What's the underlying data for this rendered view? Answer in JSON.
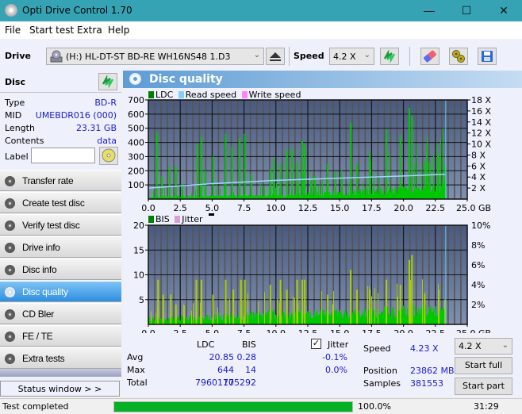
{
  "window": {
    "title": "Opti Drive Control 1.70",
    "min_icon": "minimize-icon",
    "max_icon": "maximize-icon",
    "close_icon": "close-icon"
  },
  "menu": [
    "File",
    "Start test",
    "Extra",
    "Help"
  ],
  "toolbar": {
    "drive_label": "Drive",
    "drive_value": "(H:)  HL-DT-ST BD-RE  WH16NS48 1.D3",
    "speed_label": "Speed",
    "speed_value": "4.2 X",
    "icons": [
      "drive-icon",
      "eject-icon",
      "refresh-icon",
      "eraser-icon",
      "settings-icon",
      "save-icon"
    ]
  },
  "disc": {
    "header": "Disc",
    "fields": [
      {
        "key": "Type",
        "value": "BD-R"
      },
      {
        "key": "MID",
        "value": "UMEBDR016 (000)"
      },
      {
        "key": "Length",
        "value": "23.31 GB"
      },
      {
        "key": "Contents",
        "value": "data"
      }
    ],
    "label_key": "Label",
    "label_value": ""
  },
  "nav": [
    {
      "label": "Transfer rate",
      "active": false
    },
    {
      "label": "Create test disc",
      "active": false
    },
    {
      "label": "Verify test disc",
      "active": false
    },
    {
      "label": "Drive info",
      "active": false
    },
    {
      "label": "Disc info",
      "active": false
    },
    {
      "label": "Disc quality",
      "active": true
    },
    {
      "label": "CD Bler",
      "active": false
    },
    {
      "label": "FE / TE",
      "active": false
    },
    {
      "label": "Extra tests",
      "active": false
    }
  ],
  "status_window_btn": "Status window > >",
  "panel_title": "Disc quality",
  "colors": {
    "ldc": "#008000",
    "read_speed": "#87cefa",
    "write_speed": "#ff80ff",
    "bis": "#008000",
    "jitter": "#d8a0d8",
    "bar_green": "#00c800",
    "bar_yellow": "#a8d000",
    "plot_bg_top": "#4a5a7e",
    "plot_bg_bottom": "#8090b0",
    "progress": "#06b025"
  },
  "chart_data": [
    {
      "type": "bar",
      "title": "LDC / Read speed",
      "legend": [
        "LDC",
        "Read speed",
        "Write speed"
      ],
      "legend_position": "top-left",
      "x_ticks": [
        "0.0",
        "2.5",
        "5.0",
        "7.5",
        "10.0",
        "12.5",
        "15.0",
        "17.5",
        "20.0",
        "22.5",
        "25.0 GB"
      ],
      "xlim": [
        0,
        25
      ],
      "y_ticks": [
        "100",
        "200",
        "300",
        "400",
        "500",
        "600",
        "700"
      ],
      "ylim": [
        0,
        700
      ],
      "y2_ticks": [
        "2 X",
        "4 X",
        "6 X",
        "8 X",
        "10 X",
        "12 X",
        "14 X",
        "16 X",
        "18 X"
      ],
      "y2lim": [
        0,
        18
      ],
      "grid": true,
      "end_marker_gb": 23.31,
      "ldc_peaks": [
        {
          "x": 0.6,
          "y": 470
        },
        {
          "x": 1.0,
          "y": 160
        },
        {
          "x": 1.6,
          "y": 230
        },
        {
          "x": 2.1,
          "y": 230
        },
        {
          "x": 2.6,
          "y": 110
        },
        {
          "x": 3.8,
          "y": 380
        },
        {
          "x": 4.1,
          "y": 440
        },
        {
          "x": 4.4,
          "y": 200
        },
        {
          "x": 5.0,
          "y": 300
        },
        {
          "x": 6.0,
          "y": 460
        },
        {
          "x": 6.5,
          "y": 370
        },
        {
          "x": 7.1,
          "y": 430
        },
        {
          "x": 7.5,
          "y": 460
        },
        {
          "x": 8.0,
          "y": 180
        },
        {
          "x": 9.5,
          "y": 210
        },
        {
          "x": 9.8,
          "y": 290
        },
        {
          "x": 10.3,
          "y": 250
        },
        {
          "x": 10.8,
          "y": 350
        },
        {
          "x": 11.2,
          "y": 360
        },
        {
          "x": 11.6,
          "y": 260
        },
        {
          "x": 12.0,
          "y": 410
        },
        {
          "x": 12.2,
          "y": 380
        },
        {
          "x": 13.0,
          "y": 160
        },
        {
          "x": 14.0,
          "y": 250
        },
        {
          "x": 14.6,
          "y": 190
        },
        {
          "x": 15.8,
          "y": 540
        },
        {
          "x": 16.3,
          "y": 250
        },
        {
          "x": 17.3,
          "y": 330
        },
        {
          "x": 18.6,
          "y": 490
        },
        {
          "x": 19.7,
          "y": 450
        },
        {
          "x": 20.4,
          "y": 644
        },
        {
          "x": 20.6,
          "y": 590
        },
        {
          "x": 21.6,
          "y": 270
        },
        {
          "x": 22.0,
          "y": 260
        },
        {
          "x": 22.7,
          "y": 310
        },
        {
          "x": 23.2,
          "y": 240
        }
      ],
      "ldc_baseline": [
        {
          "x": 0,
          "y": 15
        },
        {
          "x": 10,
          "y": 25
        },
        {
          "x": 15,
          "y": 40
        },
        {
          "x": 20,
          "y": 70
        },
        {
          "x": 23.31,
          "y": 90
        }
      ],
      "read_speed": [
        {
          "x": 0,
          "y": 2.0
        },
        {
          "x": 2.5,
          "y": 2.4
        },
        {
          "x": 5.0,
          "y": 2.8
        },
        {
          "x": 7.5,
          "y": 3.1
        },
        {
          "x": 10.0,
          "y": 3.4
        },
        {
          "x": 12.5,
          "y": 3.6
        },
        {
          "x": 15.0,
          "y": 3.8
        },
        {
          "x": 17.5,
          "y": 4.0
        },
        {
          "x": 20.0,
          "y": 4.2
        },
        {
          "x": 23.31,
          "y": 4.5
        }
      ]
    },
    {
      "type": "bar",
      "title": "BIS / Jitter",
      "legend": [
        "BIS",
        "Jitter"
      ],
      "legend_position": "top-left",
      "x_ticks": [
        "0.0",
        "2.5",
        "5.0",
        "7.5",
        "10.0",
        "12.5",
        "15.0",
        "17.5",
        "20.0",
        "22.5",
        "25.0 GB"
      ],
      "xlim": [
        0,
        25
      ],
      "y_ticks": [
        "5",
        "10",
        "15",
        "20"
      ],
      "ylim": [
        0,
        20
      ],
      "y2_ticks": [
        "2%",
        "4%",
        "6%",
        "8%",
        "10%"
      ],
      "y2lim": [
        0,
        10
      ],
      "grid": true,
      "end_marker_gb": 23.31,
      "bis_peaks": [
        {
          "x": 0.7,
          "y": 9
        },
        {
          "x": 1.1,
          "y": 6
        },
        {
          "x": 1.7,
          "y": 6
        },
        {
          "x": 2.1,
          "y": 4
        },
        {
          "x": 3.7,
          "y": 9
        },
        {
          "x": 4.1,
          "y": 9
        },
        {
          "x": 5.0,
          "y": 6
        },
        {
          "x": 6.0,
          "y": 9
        },
        {
          "x": 6.6,
          "y": 7
        },
        {
          "x": 7.2,
          "y": 9
        },
        {
          "x": 7.5,
          "y": 9
        },
        {
          "x": 9.5,
          "y": 8
        },
        {
          "x": 10.3,
          "y": 9
        },
        {
          "x": 10.8,
          "y": 7
        },
        {
          "x": 11.6,
          "y": 9
        },
        {
          "x": 12.0,
          "y": 9
        },
        {
          "x": 12.2,
          "y": 9
        },
        {
          "x": 14.0,
          "y": 6
        },
        {
          "x": 15.8,
          "y": 11
        },
        {
          "x": 16.3,
          "y": 7
        },
        {
          "x": 17.3,
          "y": 7
        },
        {
          "x": 18.6,
          "y": 9
        },
        {
          "x": 19.7,
          "y": 8
        },
        {
          "x": 20.4,
          "y": 13
        },
        {
          "x": 20.6,
          "y": 14
        },
        {
          "x": 21.6,
          "y": 6
        },
        {
          "x": 22.7,
          "y": 7
        },
        {
          "x": 23.2,
          "y": 5
        }
      ],
      "bis_baseline": [
        {
          "x": 0,
          "y": 1
        },
        {
          "x": 10,
          "y": 2
        },
        {
          "x": 15,
          "y": 2
        },
        {
          "x": 23.31,
          "y": 3
        }
      ]
    }
  ],
  "stats": {
    "col_ldc": "LDC",
    "col_bis": "BIS",
    "jitter_label": "Jitter",
    "jitter_checked": true,
    "rows": [
      {
        "label": "Avg",
        "ldc": "20.85",
        "bis": "0.28",
        "jitter": "-0.1%"
      },
      {
        "label": "Max",
        "ldc": "644",
        "bis": "14",
        "jitter": "0.0%"
      },
      {
        "label": "Total",
        "ldc": "7960177",
        "bis": "105292",
        "jitter": ""
      }
    ],
    "speed_label": "Speed",
    "speed_value": "4.23 X",
    "position_label": "Position",
    "position_value": "23862 MB",
    "samples_label": "Samples",
    "samples_value": "381553",
    "speed_select": "4.2 X",
    "start_full": "Start full",
    "start_part": "Start part"
  },
  "status": {
    "text": "Test completed",
    "progress_pct": 100,
    "progress_text": "100.0%",
    "time": "31:29"
  }
}
